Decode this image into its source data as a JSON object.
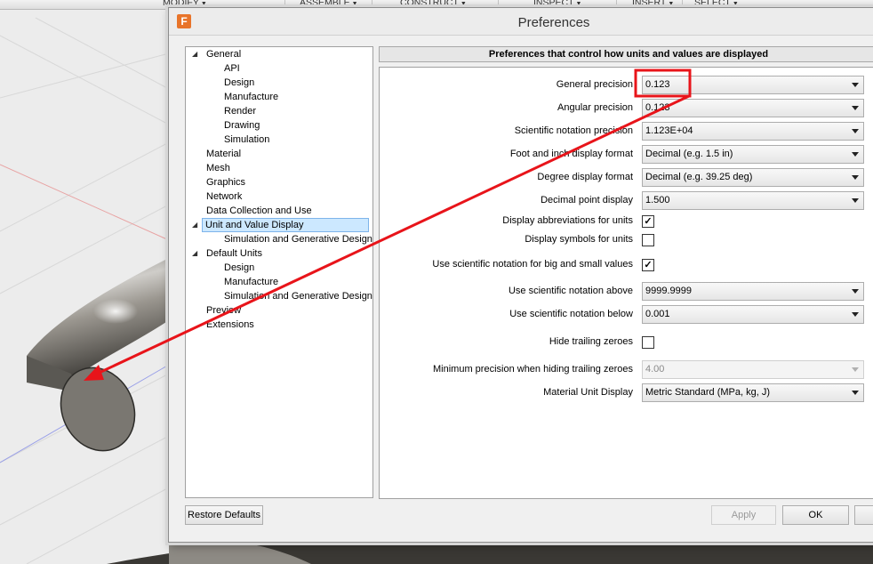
{
  "toolbar": {
    "menus": [
      "MODIFY",
      "ASSEMBLE",
      "CONSTRUCT",
      "INSPECT",
      "INSERT",
      "SELECT"
    ]
  },
  "dialog": {
    "app_icon": "F",
    "title": "Preferences"
  },
  "tree": {
    "items": [
      {
        "label": "General",
        "level": 0,
        "expanded": true
      },
      {
        "label": "API",
        "level": 1
      },
      {
        "label": "Design",
        "level": 1
      },
      {
        "label": "Manufacture",
        "level": 1
      },
      {
        "label": "Render",
        "level": 1
      },
      {
        "label": "Drawing",
        "level": 1
      },
      {
        "label": "Simulation",
        "level": 1
      },
      {
        "label": "Material",
        "level": 0
      },
      {
        "label": "Mesh",
        "level": 0
      },
      {
        "label": "Graphics",
        "level": 0
      },
      {
        "label": "Network",
        "level": 0
      },
      {
        "label": "Data Collection and Use",
        "level": 0
      },
      {
        "label": "Unit and Value Display",
        "level": 0,
        "expanded": true,
        "selected": true
      },
      {
        "label": "Simulation and Generative Design",
        "level": 1
      },
      {
        "label": "Default Units",
        "level": 0,
        "expanded": true
      },
      {
        "label": "Design",
        "level": 1
      },
      {
        "label": "Manufacture",
        "level": 1
      },
      {
        "label": "Simulation and Generative Design",
        "level": 1
      },
      {
        "label": "Preview",
        "level": 0
      },
      {
        "label": "Extensions",
        "level": 0
      }
    ]
  },
  "panel": {
    "header": "Preferences that control how units and values are displayed",
    "general_precision": {
      "label": "General precision",
      "value": "0.123"
    },
    "angular_precision": {
      "label": "Angular precision",
      "value": "0.123"
    },
    "scientific_notation_precision": {
      "label": "Scientific notation precision",
      "value": "1.123E+04"
    },
    "foot_inch_format": {
      "label": "Foot and inch display format",
      "value": "Decimal (e.g. 1.5 in)"
    },
    "degree_format": {
      "label": "Degree display format",
      "value": "Decimal (e.g. 39.25 deg)"
    },
    "decimal_point": {
      "label": "Decimal point display",
      "value": "1.500"
    },
    "display_abbreviations": {
      "label": "Display abbreviations for units",
      "checked": true
    },
    "display_symbols": {
      "label": "Display symbols for units",
      "checked": false
    },
    "use_scientific": {
      "label": "Use scientific notation for big and small values",
      "checked": true
    },
    "sci_above": {
      "label": "Use scientific notation above",
      "value": "9999.9999"
    },
    "sci_below": {
      "label": "Use scientific notation below",
      "value": "0.001"
    },
    "hide_trailing": {
      "label": "Hide trailing zeroes",
      "checked": false
    },
    "min_precision": {
      "label": "Minimum precision when hiding trailing zeroes",
      "value": "4.00",
      "disabled": true
    },
    "material_unit": {
      "label": "Material Unit Display",
      "value": "Metric Standard (MPa, kg, J)"
    }
  },
  "buttons": {
    "restore": "Restore Defaults",
    "apply": "Apply",
    "ok": "OK"
  },
  "colors": {
    "annotation": "#e8141a",
    "selection": "#cce8ff"
  }
}
